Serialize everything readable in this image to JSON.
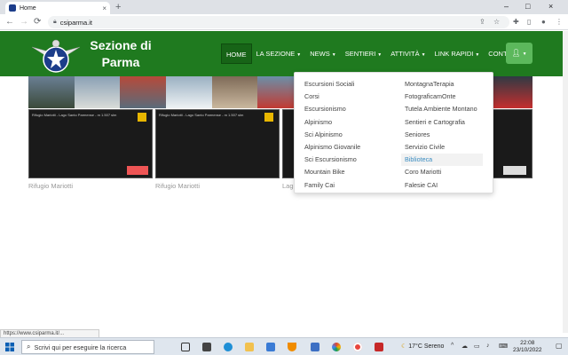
{
  "browser": {
    "tab_title": "Home",
    "close_tab": "×",
    "new_tab": "+",
    "url": "csiparma.it",
    "window_controls": [
      "–",
      "□",
      "×"
    ]
  },
  "site": {
    "brand_line1": "Sezione di",
    "brand_line2": "Parma",
    "nav": [
      {
        "label": "HOME",
        "caret": false
      },
      {
        "label": "LA SEZIONE",
        "caret": true
      },
      {
        "label": "NEWS",
        "caret": true
      },
      {
        "label": "SENTIERI",
        "caret": true
      },
      {
        "label": "ATTIVITÀ",
        "caret": true
      },
      {
        "label": "LINK RAPIDI",
        "caret": true
      },
      {
        "label": "CONTATTI",
        "caret": false
      }
    ],
    "dropdown_left": [
      "Escursioni Sociali",
      "Corsi",
      "Escursionismo",
      "Alpinismo",
      "Sci Alpinismo",
      "Alpinismo Giovanile",
      "Sci Escursionismo",
      "Mountain Bike",
      "Family Cai"
    ],
    "dropdown_right": [
      "MontagnaTerapia",
      "FotograficamOnte",
      "Tutela Ambiente Montano",
      "Sentieri e Cartografia",
      "Seniores",
      "Servizio Civile",
      "Biblioteca",
      "Coro Mariotti",
      "Falesie CAI"
    ],
    "cam_labels": [
      "Rifugio Mariotti",
      "Rifugio Mariotti",
      "Lag"
    ],
    "cam_caption": "Rifugio Mariotti - Lago Santo Parmense - m 1.507 slm"
  },
  "status": {
    "text": "https://www.csiparma.it/..."
  },
  "taskbar": {
    "search_placeholder": "Scrivi qui per eseguire la ricerca",
    "weather": "17°C  Sereno",
    "time": "22:08",
    "date": "23/10/2022"
  },
  "colors": {
    "header_green": "#1f7a1f",
    "highlight_blue": "#3a8cc1",
    "user_button": "#5cb85c"
  }
}
